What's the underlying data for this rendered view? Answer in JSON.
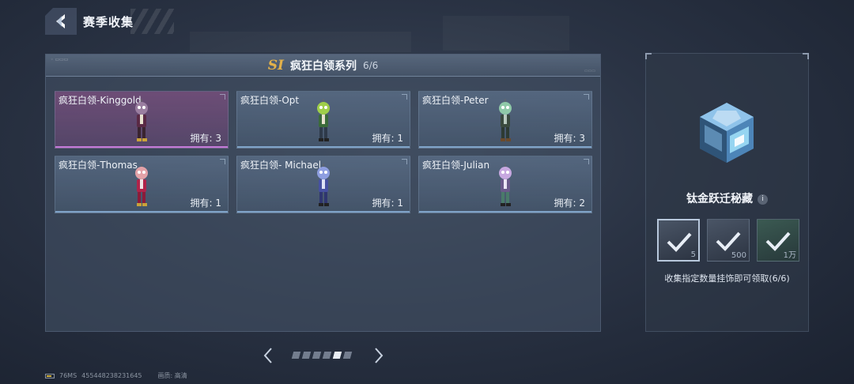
{
  "header": {
    "title": "赛季收集"
  },
  "series": {
    "season_badge": "SI",
    "title": "疯狂白领系列",
    "progress": "6/6"
  },
  "cards": [
    {
      "name": "疯狂白领-Kinggold",
      "owned": "拥有: 3",
      "selected": true
    },
    {
      "name": "疯狂白领-Opt",
      "owned": "拥有: 1",
      "selected": false
    },
    {
      "name": "疯狂白领-Peter",
      "owned": "拥有: 3",
      "selected": false
    },
    {
      "name": "疯狂白领-Thomas",
      "owned": "拥有: 1",
      "selected": false
    },
    {
      "name": "疯狂白领- Michael",
      "owned": "拥有: 1",
      "selected": false
    },
    {
      "name": "疯狂白领-Julian",
      "owned": "拥有: 2",
      "selected": false
    }
  ],
  "pagination": {
    "total_pages": 6,
    "current_page": 5
  },
  "reward": {
    "title": "钛金跃迁秘藏",
    "info_icon": "i",
    "tiers": [
      {
        "qty": "5",
        "claimed": true
      },
      {
        "qty": "500",
        "claimed": true
      },
      {
        "qty": "1万",
        "claimed": true
      }
    ],
    "description": "收集指定数量挂饰即可领取(6/6)"
  },
  "status": {
    "ping": "76MS",
    "uid": "455448238231645",
    "quality": "画质: 高清"
  },
  "colors": {
    "accent_gold": "#e2b14a",
    "selected_card": "#c37ad8",
    "card_underline": "#7fa3c8"
  }
}
